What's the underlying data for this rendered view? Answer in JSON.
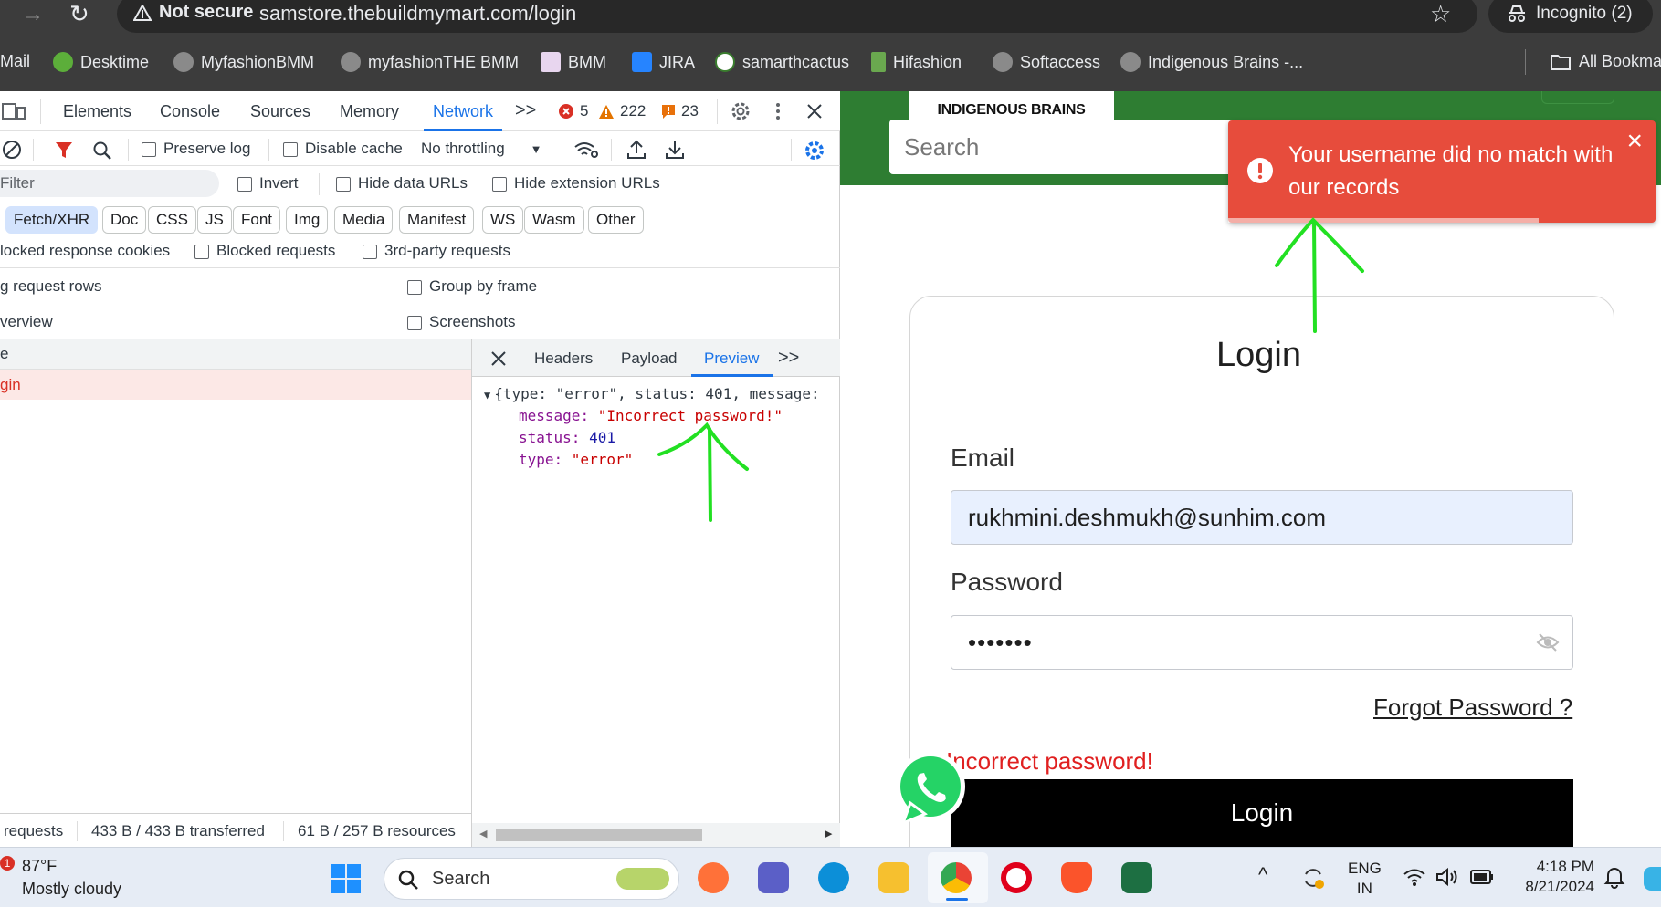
{
  "browser": {
    "nav_forward": "→",
    "reload": "↻",
    "security_label": "Not secure",
    "url": "samstore.thebuildmymart.com/login",
    "incognito_label": "Incognito (2)",
    "bookmarks": [
      "Mail",
      "Desktime",
      "MyfashionBMM",
      "myfashionTHE BMM",
      "BMM",
      "JIRA",
      "samarthcactus",
      "Hifashion",
      "Softaccess",
      "Indigenous Brains -...",
      "All Bookma"
    ]
  },
  "devtools": {
    "tabs": [
      "Elements",
      "Console",
      "Sources",
      "Memory",
      "Network"
    ],
    "active_tab": "Network",
    "more": ">>",
    "errors_count": "5",
    "warnings_count": "222",
    "issues_count": "23",
    "preserve_log": "Preserve log",
    "disable_cache": "Disable cache",
    "throttling": "No throttling",
    "filter_placeholder": "Filter",
    "invert": "Invert",
    "hide_data_urls": "Hide data URLs",
    "hide_extension_urls": "Hide extension URLs",
    "type_filters": [
      "Fetch/XHR",
      "Doc",
      "CSS",
      "JS",
      "Font",
      "Img",
      "Media",
      "Manifest",
      "WS",
      "Wasm",
      "Other"
    ],
    "blocked_cookies": "locked response cookies",
    "blocked_requests": "Blocked requests",
    "third_party": "3rd-party requests",
    "big_rows": "g request rows",
    "group_by_frame": "Group by frame",
    "overview": "verview",
    "screenshots": "Screenshots",
    "name_col": "e",
    "request_name": "gin",
    "detail_tabs": [
      "Headers",
      "Payload",
      "Preview",
      ">>"
    ],
    "active_detail_tab": "Preview",
    "preview_summary": "{type: \"error\", status: 401, message:",
    "preview_fields": [
      {
        "key": "message",
        "value": "\"Incorrect password!\""
      },
      {
        "key": "status",
        "value": "401"
      },
      {
        "key": "type",
        "value": "\"error\""
      }
    ],
    "status_requests": "requests",
    "status_transferred": "433 B / 433 B transferred",
    "status_resources": "61 B / 257 B resources"
  },
  "page": {
    "logo_text": "INDIGENOUS BRAINS",
    "search_placeholder": "Search",
    "toast_message": "Your username did no match with our records",
    "toast_close": "×",
    "login_title": "Login",
    "email_label": "Email",
    "email_value": "rukhmini.deshmukh@sunhim.com",
    "password_label": "Password",
    "password_value": "•••••••",
    "forgot_password": "Forgot Password ?",
    "error_message": "Incorrect password!",
    "login_button": "Login"
  },
  "taskbar": {
    "weather_badge": "1",
    "temperature": "87°F",
    "weather_desc": "Mostly cloudy",
    "search_label": "Search",
    "lang_top": "ENG",
    "lang_bottom": "IN",
    "time": "4:18 PM",
    "date": "8/21/2024"
  },
  "colors": {
    "accent_green": "#2e7d32",
    "toast_red": "#e74c3c",
    "devtools_blue": "#1a73e8",
    "annotation_green": "#22e022"
  }
}
